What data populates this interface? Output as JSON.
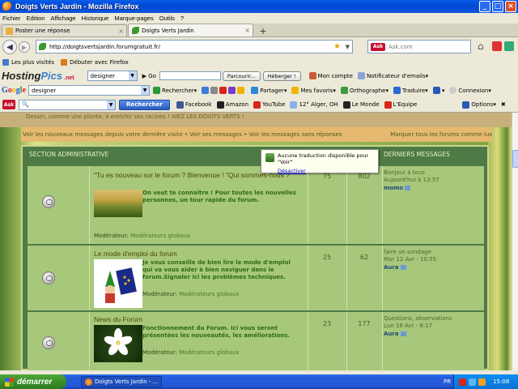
{
  "window": {
    "title": "Doigts Verts Jardin - Mozilla Firefox",
    "controls": [
      "_",
      "□",
      "×"
    ]
  },
  "menu": [
    "Fichier",
    "Edition",
    "Affichage",
    "Historique",
    "Marque-pages",
    "Outils",
    "?"
  ],
  "tabs": [
    {
      "label": "Poster une réponse",
      "active": false
    },
    {
      "label": "Doigts Verts Jardin",
      "active": true
    }
  ],
  "newtab": "+",
  "nav": {
    "url": "http://doigtsvertsjardin.forumgratuit.fr/",
    "search_placeholder": "Ask.com",
    "ask_badge": "Ask"
  },
  "bookmarks": [
    "Les plus visités",
    "Débuter avec Firefox"
  ],
  "hostingpics": {
    "logo_main": "Hosting",
    "logo_pics": "Pics",
    "logo_net": ".net",
    "select": "designer",
    "go": "Go",
    "browse": "Parcourir...",
    "host": "Héberger !",
    "account": "Mon compte",
    "notifier": "Notificateur d'emails"
  },
  "google": {
    "logo": "Google",
    "input": "designer",
    "search": "Rechercher",
    "share": "Partager",
    "favorites": "Mes favoris",
    "spelling": "Orthographe",
    "translate": "Traduire",
    "connect": "Connexion"
  },
  "ask": {
    "button": "Rechercher",
    "links": [
      "Facebook",
      "Amazon",
      "YouTube",
      "12° Alger, OH",
      "Le Monde",
      "L'Equipe"
    ],
    "options": "Options"
  },
  "forum": {
    "top_strip": "Dessin, comme une plante, à enrichir ses racines ! AIEZ LES DOIGTS VERTS !",
    "links_left": "Voir les nouveaux messages depuis votre dernière visite • Voir ses messages • Voir les messages sans réponses",
    "links_right": "Marquer tous les forums comme lus",
    "section_title": "SECTION ADMINISTRATIVE",
    "last_messages_header": "DERNIERS MESSAGES",
    "rows": [
      {
        "title": "\"Tu es nouveau sur le forum ? Bienvenue ! \"Qui sommes-nous ?",
        "desc": "On veut te connaître ! Pour toutes les nouvelles personnes, un tour rapide du forum.",
        "mod_label": "Modérateur:",
        "mod_value": "Modérateurs globaux",
        "topics": "75",
        "posts": "802",
        "last_title": "Bonjour à tous",
        "last_date": "Aujourd'hui à 13:57",
        "last_author": "momo"
      },
      {
        "title": "Le mode d'emploi du forum",
        "desc": "Je vous conseille de bien lire le mode d'emploi qui va vous aider à bien naviguer dans le forum.Signaler ici les problèmes techniques.",
        "mod_label": "Modérateur:",
        "mod_value": "Modérateurs globaux",
        "topics": "25",
        "posts": "62",
        "last_title": "faire un sondage",
        "last_date": "Mar 12 Avr - 10:55",
        "last_author": "Aura"
      },
      {
        "title": "News du Forum",
        "desc": "Fonctionnement du Forum. Ici vous seront présentées les nouveautés, les améliorations.",
        "mod_label": "Modérateur:",
        "mod_value": "Modérateurs globaux",
        "topics": "23",
        "posts": "177",
        "last_title": "Questions, observations",
        "last_date": "Lun 18 Avr - 8:17",
        "last_author": "Aura"
      }
    ]
  },
  "tooltip": {
    "text": "Aucune traduction disponible pour \"Voir\"",
    "link": "Désactiver"
  },
  "taskbar": {
    "start": "démarrer",
    "task": "Doigts Verts Jardin - ...",
    "lang": "PR",
    "clock": "15:08"
  }
}
